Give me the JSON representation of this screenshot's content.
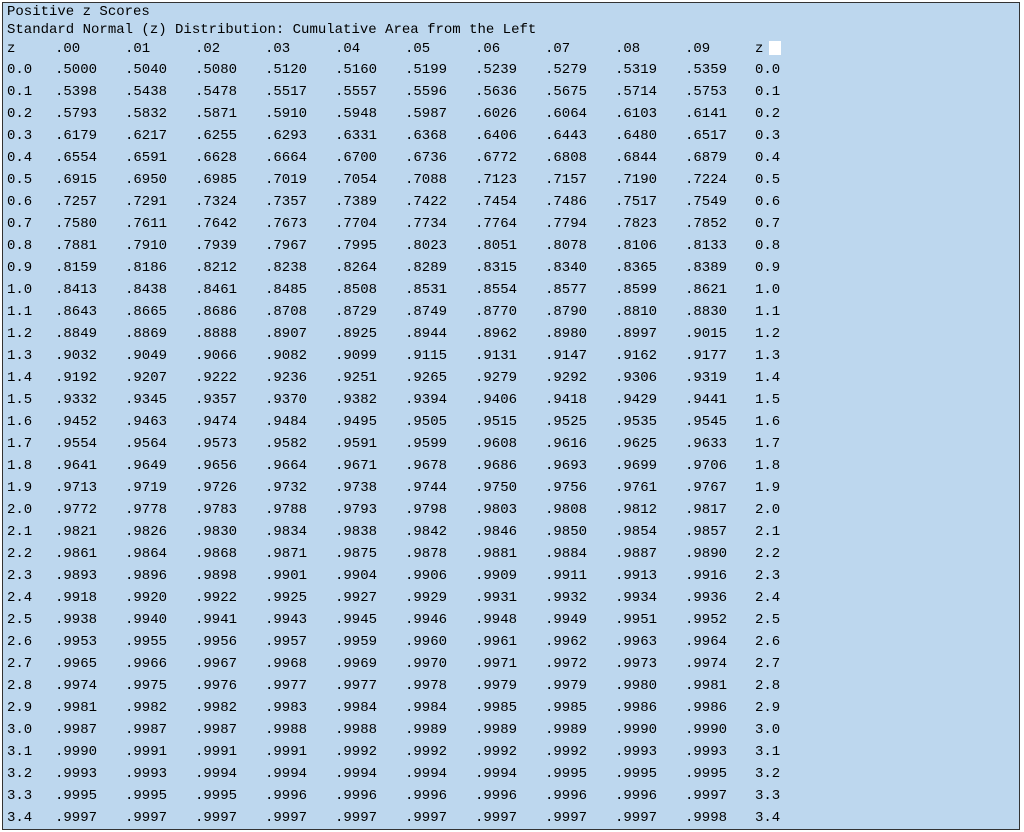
{
  "title1": "Positive z Scores",
  "title2": "Standard Normal (z) Distribution: Cumulative Area from the Left",
  "header": {
    "z_left": "z",
    "cols": [
      ".00",
      ".01",
      ".02",
      ".03",
      ".04",
      ".05",
      ".06",
      ".07",
      ".08",
      ".09"
    ],
    "z_right": "z"
  },
  "chart_data": {
    "type": "table",
    "title": "Standard Normal (z) Distribution: Cumulative Area from the Left",
    "row_labels": [
      "0.0",
      "0.1",
      "0.2",
      "0.3",
      "0.4",
      "0.5",
      "0.6",
      "0.7",
      "0.8",
      "0.9",
      "1.0",
      "1.1",
      "1.2",
      "1.3",
      "1.4",
      "1.5",
      "1.6",
      "1.7",
      "1.8",
      "1.9",
      "2.0",
      "2.1",
      "2.2",
      "2.3",
      "2.4",
      "2.5",
      "2.6",
      "2.7",
      "2.8",
      "2.9",
      "3.0",
      "3.1",
      "3.2",
      "3.3",
      "3.4"
    ],
    "col_labels": [
      ".00",
      ".01",
      ".02",
      ".03",
      ".04",
      ".05",
      ".06",
      ".07",
      ".08",
      ".09"
    ],
    "values": [
      [
        ".5000",
        ".5040",
        ".5080",
        ".5120",
        ".5160",
        ".5199",
        ".5239",
        ".5279",
        ".5319",
        ".5359"
      ],
      [
        ".5398",
        ".5438",
        ".5478",
        ".5517",
        ".5557",
        ".5596",
        ".5636",
        ".5675",
        ".5714",
        ".5753"
      ],
      [
        ".5793",
        ".5832",
        ".5871",
        ".5910",
        ".5948",
        ".5987",
        ".6026",
        ".6064",
        ".6103",
        ".6141"
      ],
      [
        ".6179",
        ".6217",
        ".6255",
        ".6293",
        ".6331",
        ".6368",
        ".6406",
        ".6443",
        ".6480",
        ".6517"
      ],
      [
        ".6554",
        ".6591",
        ".6628",
        ".6664",
        ".6700",
        ".6736",
        ".6772",
        ".6808",
        ".6844",
        ".6879"
      ],
      [
        ".6915",
        ".6950",
        ".6985",
        ".7019",
        ".7054",
        ".7088",
        ".7123",
        ".7157",
        ".7190",
        ".7224"
      ],
      [
        ".7257",
        ".7291",
        ".7324",
        ".7357",
        ".7389",
        ".7422",
        ".7454",
        ".7486",
        ".7517",
        ".7549"
      ],
      [
        ".7580",
        ".7611",
        ".7642",
        ".7673",
        ".7704",
        ".7734",
        ".7764",
        ".7794",
        ".7823",
        ".7852"
      ],
      [
        ".7881",
        ".7910",
        ".7939",
        ".7967",
        ".7995",
        ".8023",
        ".8051",
        ".8078",
        ".8106",
        ".8133"
      ],
      [
        ".8159",
        ".8186",
        ".8212",
        ".8238",
        ".8264",
        ".8289",
        ".8315",
        ".8340",
        ".8365",
        ".8389"
      ],
      [
        ".8413",
        ".8438",
        ".8461",
        ".8485",
        ".8508",
        ".8531",
        ".8554",
        ".8577",
        ".8599",
        ".8621"
      ],
      [
        ".8643",
        ".8665",
        ".8686",
        ".8708",
        ".8729",
        ".8749",
        ".8770",
        ".8790",
        ".8810",
        ".8830"
      ],
      [
        ".8849",
        ".8869",
        ".8888",
        ".8907",
        ".8925",
        ".8944",
        ".8962",
        ".8980",
        ".8997",
        ".9015"
      ],
      [
        ".9032",
        ".9049",
        ".9066",
        ".9082",
        ".9099",
        ".9115",
        ".9131",
        ".9147",
        ".9162",
        ".9177"
      ],
      [
        ".9192",
        ".9207",
        ".9222",
        ".9236",
        ".9251",
        ".9265",
        ".9279",
        ".9292",
        ".9306",
        ".9319"
      ],
      [
        ".9332",
        ".9345",
        ".9357",
        ".9370",
        ".9382",
        ".9394",
        ".9406",
        ".9418",
        ".9429",
        ".9441"
      ],
      [
        ".9452",
        ".9463",
        ".9474",
        ".9484",
        ".9495",
        ".9505",
        ".9515",
        ".9525",
        ".9535",
        ".9545"
      ],
      [
        ".9554",
        ".9564",
        ".9573",
        ".9582",
        ".9591",
        ".9599",
        ".9608",
        ".9616",
        ".9625",
        ".9633"
      ],
      [
        ".9641",
        ".9649",
        ".9656",
        ".9664",
        ".9671",
        ".9678",
        ".9686",
        ".9693",
        ".9699",
        ".9706"
      ],
      [
        ".9713",
        ".9719",
        ".9726",
        ".9732",
        ".9738",
        ".9744",
        ".9750",
        ".9756",
        ".9761",
        ".9767"
      ],
      [
        ".9772",
        ".9778",
        ".9783",
        ".9788",
        ".9793",
        ".9798",
        ".9803",
        ".9808",
        ".9812",
        ".9817"
      ],
      [
        ".9821",
        ".9826",
        ".9830",
        ".9834",
        ".9838",
        ".9842",
        ".9846",
        ".9850",
        ".9854",
        ".9857"
      ],
      [
        ".9861",
        ".9864",
        ".9868",
        ".9871",
        ".9875",
        ".9878",
        ".9881",
        ".9884",
        ".9887",
        ".9890"
      ],
      [
        ".9893",
        ".9896",
        ".9898",
        ".9901",
        ".9904",
        ".9906",
        ".9909",
        ".9911",
        ".9913",
        ".9916"
      ],
      [
        ".9918",
        ".9920",
        ".9922",
        ".9925",
        ".9927",
        ".9929",
        ".9931",
        ".9932",
        ".9934",
        ".9936"
      ],
      [
        ".9938",
        ".9940",
        ".9941",
        ".9943",
        ".9945",
        ".9946",
        ".9948",
        ".9949",
        ".9951",
        ".9952"
      ],
      [
        ".9953",
        ".9955",
        ".9956",
        ".9957",
        ".9959",
        ".9960",
        ".9961",
        ".9962",
        ".9963",
        ".9964"
      ],
      [
        ".9965",
        ".9966",
        ".9967",
        ".9968",
        ".9969",
        ".9970",
        ".9971",
        ".9972",
        ".9973",
        ".9974"
      ],
      [
        ".9974",
        ".9975",
        ".9976",
        ".9977",
        ".9977",
        ".9978",
        ".9979",
        ".9979",
        ".9980",
        ".9981"
      ],
      [
        ".9981",
        ".9982",
        ".9982",
        ".9983",
        ".9984",
        ".9984",
        ".9985",
        ".9985",
        ".9986",
        ".9986"
      ],
      [
        ".9987",
        ".9987",
        ".9987",
        ".9988",
        ".9988",
        ".9989",
        ".9989",
        ".9989",
        ".9990",
        ".9990"
      ],
      [
        ".9990",
        ".9991",
        ".9991",
        ".9991",
        ".9992",
        ".9992",
        ".9992",
        ".9992",
        ".9993",
        ".9993"
      ],
      [
        ".9993",
        ".9993",
        ".9994",
        ".9994",
        ".9994",
        ".9994",
        ".9994",
        ".9995",
        ".9995",
        ".9995"
      ],
      [
        ".9995",
        ".9995",
        ".9995",
        ".9996",
        ".9996",
        ".9996",
        ".9996",
        ".9996",
        ".9996",
        ".9997"
      ],
      [
        ".9997",
        ".9997",
        ".9997",
        ".9997",
        ".9997",
        ".9997",
        ".9997",
        ".9997",
        ".9997",
        ".9998"
      ]
    ]
  }
}
